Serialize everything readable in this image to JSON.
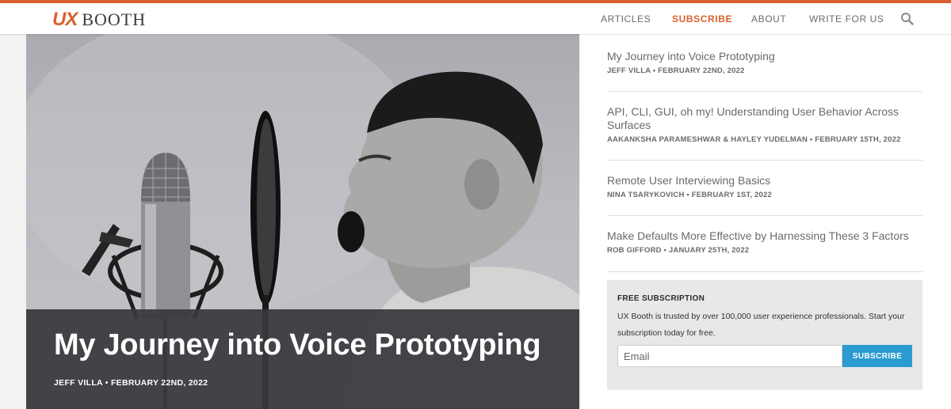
{
  "site": {
    "logo_ux": "UX",
    "logo_booth": "BOOTH",
    "brand_color": "#d9602b",
    "accent_color": "#2b9bd1"
  },
  "nav": {
    "items": [
      {
        "label": "ARTICLES",
        "active": false
      },
      {
        "label": "SUBSCRIBE",
        "active": true
      },
      {
        "label": "ABOUT",
        "active": false
      },
      {
        "label": "WRITE FOR US",
        "active": false
      }
    ],
    "search_icon": "search-icon"
  },
  "hero": {
    "image": "black-and-white photo of a boy shouting into a studio microphone with pop filter",
    "title": "My Journey into Voice Prototyping",
    "meta": "JEFF VILLA • FEBRUARY 22ND, 2022"
  },
  "sidebar": {
    "articles": [
      {
        "title": "My Journey into Voice Prototyping",
        "meta": "JEFF VILLA • FEBRUARY 22ND, 2022"
      },
      {
        "title": "API, CLI, GUI, oh my! Understanding User Behavior Across Surfaces",
        "meta": "AAKANKSHA PARAMESHWAR & HAYLEY YUDELMAN • FEBRUARY 15TH, 2022"
      },
      {
        "title": "Remote User Interviewing Basics",
        "meta": "NINA TSARYKOVICH • FEBRUARY 1ST, 2022"
      },
      {
        "title": "Make Defaults More Effective by Harnessing These 3 Factors",
        "meta": "ROB GIFFORD • JANUARY 25TH, 2022"
      }
    ],
    "subscription": {
      "heading": "FREE SUBSCRIPTION",
      "text": "UX Booth is trusted by over 100,000 user experience professionals. Start your subscription today for free.",
      "email_placeholder": "Email",
      "button_label": "SUBSCRIBE"
    }
  }
}
